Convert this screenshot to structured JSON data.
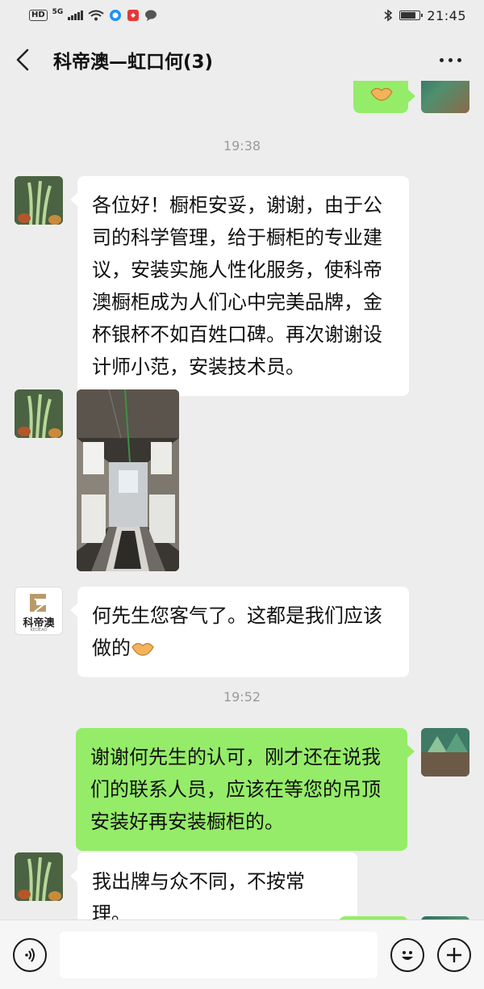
{
  "status_bar": {
    "hd": "HD",
    "network": "5G",
    "time": "21:45",
    "battery_level": 0.8
  },
  "header": {
    "title": "科帝澳—虹口何(3)"
  },
  "messages": {
    "ts1": "19:38",
    "msg1": "各位好！橱柜安妥，谢谢，由于公司的科学管理，给于橱柜的专业建议，安装实施人性化服务，使科帝澳橱柜成为人们心中完美品牌，金杯银杯不如百姓口碑。再次谢谢设计师小范，安装技术员。",
    "photo_caption": "",
    "msg3": "何先生您客气了。这都是我们应该做的",
    "ts2": "19:52",
    "msg4": "谢谢何先生的认可，刚才还在说我们的联系人员，应该在等您的吊顶安装好再安装橱柜的。",
    "msg5": "我出牌与众不同，不按常理。"
  },
  "logo": {
    "brand": "科帝澳",
    "sub": "KEDEAO"
  },
  "input": {
    "placeholder": ""
  },
  "colors": {
    "background": "#ededed",
    "incoming_bubble": "#ffffff",
    "outgoing_bubble": "#95ec69",
    "timestamp": "#9a9a9a"
  },
  "icons": [
    "back-icon",
    "more-icon",
    "voice-icon",
    "emoji-icon",
    "plus-icon",
    "handshake-icon"
  ]
}
